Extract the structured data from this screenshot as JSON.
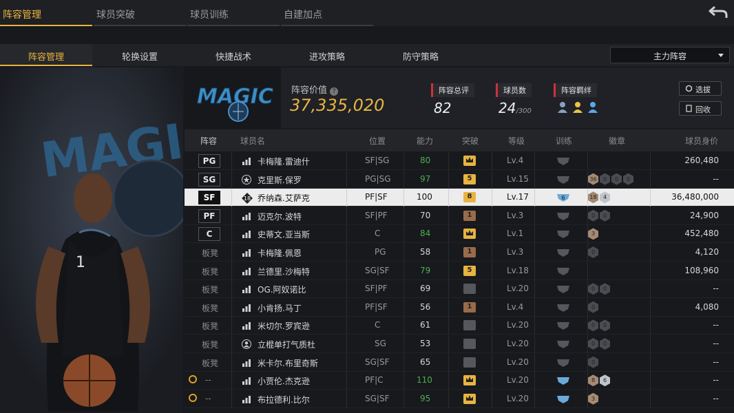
{
  "top_tabs": [
    "阵容管理",
    "球员突破",
    "球员训练",
    "自建加点"
  ],
  "sub_tabs": [
    "阵容管理",
    "轮换设置",
    "快捷战术",
    "进攻策略",
    "防守策略"
  ],
  "lineup_select": "主力阵容",
  "summary": {
    "value_label": "阵容价值",
    "value": "37,335,020",
    "rating_label": "阵容总评",
    "rating": "82",
    "players_label": "球员数",
    "players": "24",
    "players_max": "/300",
    "bond_label": "阵容羁绊",
    "btn_select": "选拔",
    "btn_recycle": "回收"
  },
  "columns": [
    "阵容",
    "球员名",
    "位置",
    "能力",
    "突破",
    "等级",
    "训练",
    "徽章",
    "球员身价"
  ],
  "rows": [
    {
      "slot": "PG",
      "type": "pos",
      "icon": "bars",
      "name": "卡梅隆.雷迪什",
      "pos": "SF|SG",
      "abl": "80",
      "ablc": "#4caf50",
      "brk": "crown",
      "brkc": "#e8b441",
      "lvl": "Lv.4",
      "trn": "grey",
      "badges": [],
      "price": "260,480"
    },
    {
      "slot": "SG",
      "type": "pos",
      "icon": "star",
      "name": "克里斯.保罗",
      "pos": "PG|SG",
      "abl": "97",
      "ablc": "#4caf50",
      "brk": "5",
      "brkc": "#e8b441",
      "lvl": "Lv.15",
      "trn": "grey",
      "badges": [
        "36",
        "0",
        "0",
        "0"
      ],
      "price": "--"
    },
    {
      "slot": "SF",
      "type": "pos",
      "icon": "num18",
      "name": "乔纳森.艾萨克",
      "pos": "PF|SF",
      "abl": "100",
      "ablc": "#111",
      "brk": "8",
      "brkc": "#e8b441",
      "lvl": "Lv.17",
      "trn": "6",
      "badges": [
        "18",
        "4"
      ],
      "price": "36,480,000",
      "sel": true
    },
    {
      "slot": "PF",
      "type": "pos",
      "icon": "bars",
      "name": "迈克尔.波特",
      "pos": "SF|PF",
      "abl": "70",
      "ablc": "#d8d8d8",
      "brk": "1",
      "brkc": "#9a6b4a",
      "lvl": "Lv.3",
      "trn": "grey",
      "badges": [
        "0",
        "0"
      ],
      "price": "24,900"
    },
    {
      "slot": "C",
      "type": "pos",
      "icon": "bars",
      "name": "史蒂文.亚当斯",
      "pos": "C",
      "abl": "84",
      "ablc": "#4caf50",
      "brk": "crown",
      "brkc": "#e8b441",
      "lvl": "Lv.1",
      "trn": "grey",
      "badges": [
        "3"
      ],
      "price": "452,480"
    },
    {
      "slot": "板凳",
      "type": "bench",
      "icon": "bars",
      "name": "卡梅隆.佩恩",
      "pos": "PG",
      "abl": "58",
      "ablc": "#d8d8d8",
      "brk": "1",
      "brkc": "#9a6b4a",
      "lvl": "Lv.3",
      "trn": "grey",
      "badges": [
        "0"
      ],
      "price": "4,120"
    },
    {
      "slot": "板凳",
      "type": "bench",
      "icon": "bars",
      "name": "兰德里.沙梅特",
      "pos": "SG|SF",
      "abl": "79",
      "ablc": "#4caf50",
      "brk": "5",
      "brkc": "#e8b441",
      "lvl": "Lv.18",
      "trn": "grey",
      "badges": [],
      "price": "108,960"
    },
    {
      "slot": "板凳",
      "type": "bench",
      "icon": "bars",
      "name": "OG.阿奴诺比",
      "pos": "SF|PF",
      "abl": "69",
      "ablc": "#d8d8d8",
      "brk": "",
      "brkc": "#666",
      "lvl": "Lv.20",
      "trn": "grey",
      "badges": [
        "0",
        "0"
      ],
      "price": "--"
    },
    {
      "slot": "板凳",
      "type": "bench",
      "icon": "bars",
      "name": "小肯扬.马丁",
      "pos": "PF|SF",
      "abl": "56",
      "ablc": "#d8d8d8",
      "brk": "1",
      "brkc": "#9a6b4a",
      "lvl": "Lv.4",
      "trn": "grey",
      "badges": [
        "0"
      ],
      "price": "4,080"
    },
    {
      "slot": "板凳",
      "type": "bench",
      "icon": "bars",
      "name": "米切尔.罗宾逊",
      "pos": "C",
      "abl": "61",
      "ablc": "#d8d8d8",
      "brk": "",
      "brkc": "#666",
      "lvl": "Lv.20",
      "trn": "grey",
      "badges": [
        "0",
        "0"
      ],
      "price": "--"
    },
    {
      "slot": "板凳",
      "type": "bench",
      "icon": "person",
      "name": "立棍单打气质杜",
      "pos": "SG",
      "abl": "53",
      "ablc": "#d8d8d8",
      "brk": "",
      "brkc": "#666",
      "lvl": "Lv.20",
      "trn": "grey",
      "badges": [
        "0",
        "0"
      ],
      "price": "--"
    },
    {
      "slot": "板凳",
      "type": "bench",
      "icon": "bars",
      "name": "米卡尔.布里奇斯",
      "pos": "SG|SF",
      "abl": "65",
      "ablc": "#d8d8d8",
      "brk": "",
      "brkc": "#666",
      "lvl": "Lv.20",
      "trn": "grey",
      "badges": [
        "0"
      ],
      "price": "--"
    },
    {
      "slot": "--",
      "type": "alarm",
      "icon": "bars",
      "name": "小贾伦.杰克逊",
      "pos": "PF|C",
      "abl": "110",
      "ablc": "#4caf50",
      "brk": "crown",
      "brkc": "#e8b441",
      "lvl": "Lv.20",
      "trn": "blue",
      "badges": [
        "8",
        "6"
      ],
      "price": "--"
    },
    {
      "slot": "--",
      "type": "alarm",
      "icon": "bars",
      "name": "布拉德利.比尔",
      "pos": "SG|SF",
      "abl": "95",
      "ablc": "#4caf50",
      "brk": "crown",
      "brkc": "#e8b441",
      "lvl": "Lv.20",
      "trn": "blue",
      "badges": [
        "3"
      ],
      "price": "--"
    }
  ]
}
